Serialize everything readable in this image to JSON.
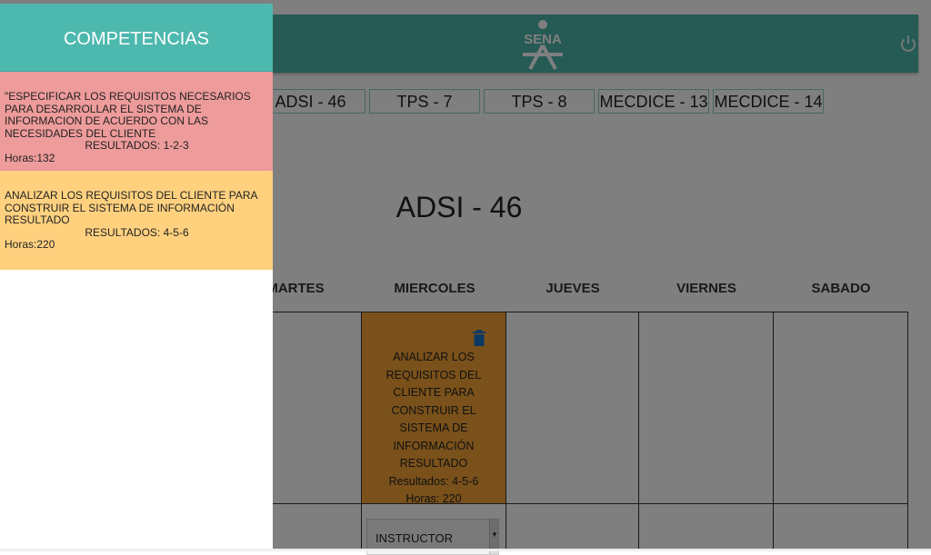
{
  "drawer": {
    "title": "COMPETENCIAS",
    "competencias": [
      {
        "text": "\"ESPECIFICAR LOS REQUISITOS NECESARIOS PARA DESARROLLAR EL SISTEMA DE INFORMACION DE ACUERDO CON LAS NECESIDADES DEL CLIENTE",
        "resultados": "RESULTADOS: 1-2-3",
        "horas": "Horas:132",
        "color": "#ee9b9b"
      },
      {
        "text": "ANALIZAR LOS REQUISITOS DEL CLIENTE PARA CONSTRUIR EL SISTEMA DE INFORMACIÓN RESULTADO",
        "resultados": "RESULTADOS: 4-5-6",
        "horas": "Horas:220",
        "color": "#ffd17f"
      }
    ]
  },
  "header": {
    "logo_text": "SENA",
    "power_icon": "power-icon",
    "color": "#4cb5a8"
  },
  "group_tabs": [
    "ADSI - 46",
    "TPS - 7",
    "TPS - 8",
    "MECDICE - 13",
    "MECDICE - 14"
  ],
  "schedule": {
    "title": "ADSI - 46",
    "days": [
      "MARTES",
      "MIERCOLES",
      "JUEVES",
      "VIERNES",
      "SABADO"
    ],
    "assigned_block": {
      "text": "ANALIZAR LOS REQUISITOS DEL CLIENTE PARA CONSTRUIR EL SISTEMA DE INFORMACIÓN RESULTADO",
      "resultados": "Resultados: 4-5-6",
      "horas": "Horas: 220",
      "color": "#f4a235",
      "delete_icon": "trash-icon"
    },
    "instructor_select": "INSTRUCTOR"
  }
}
